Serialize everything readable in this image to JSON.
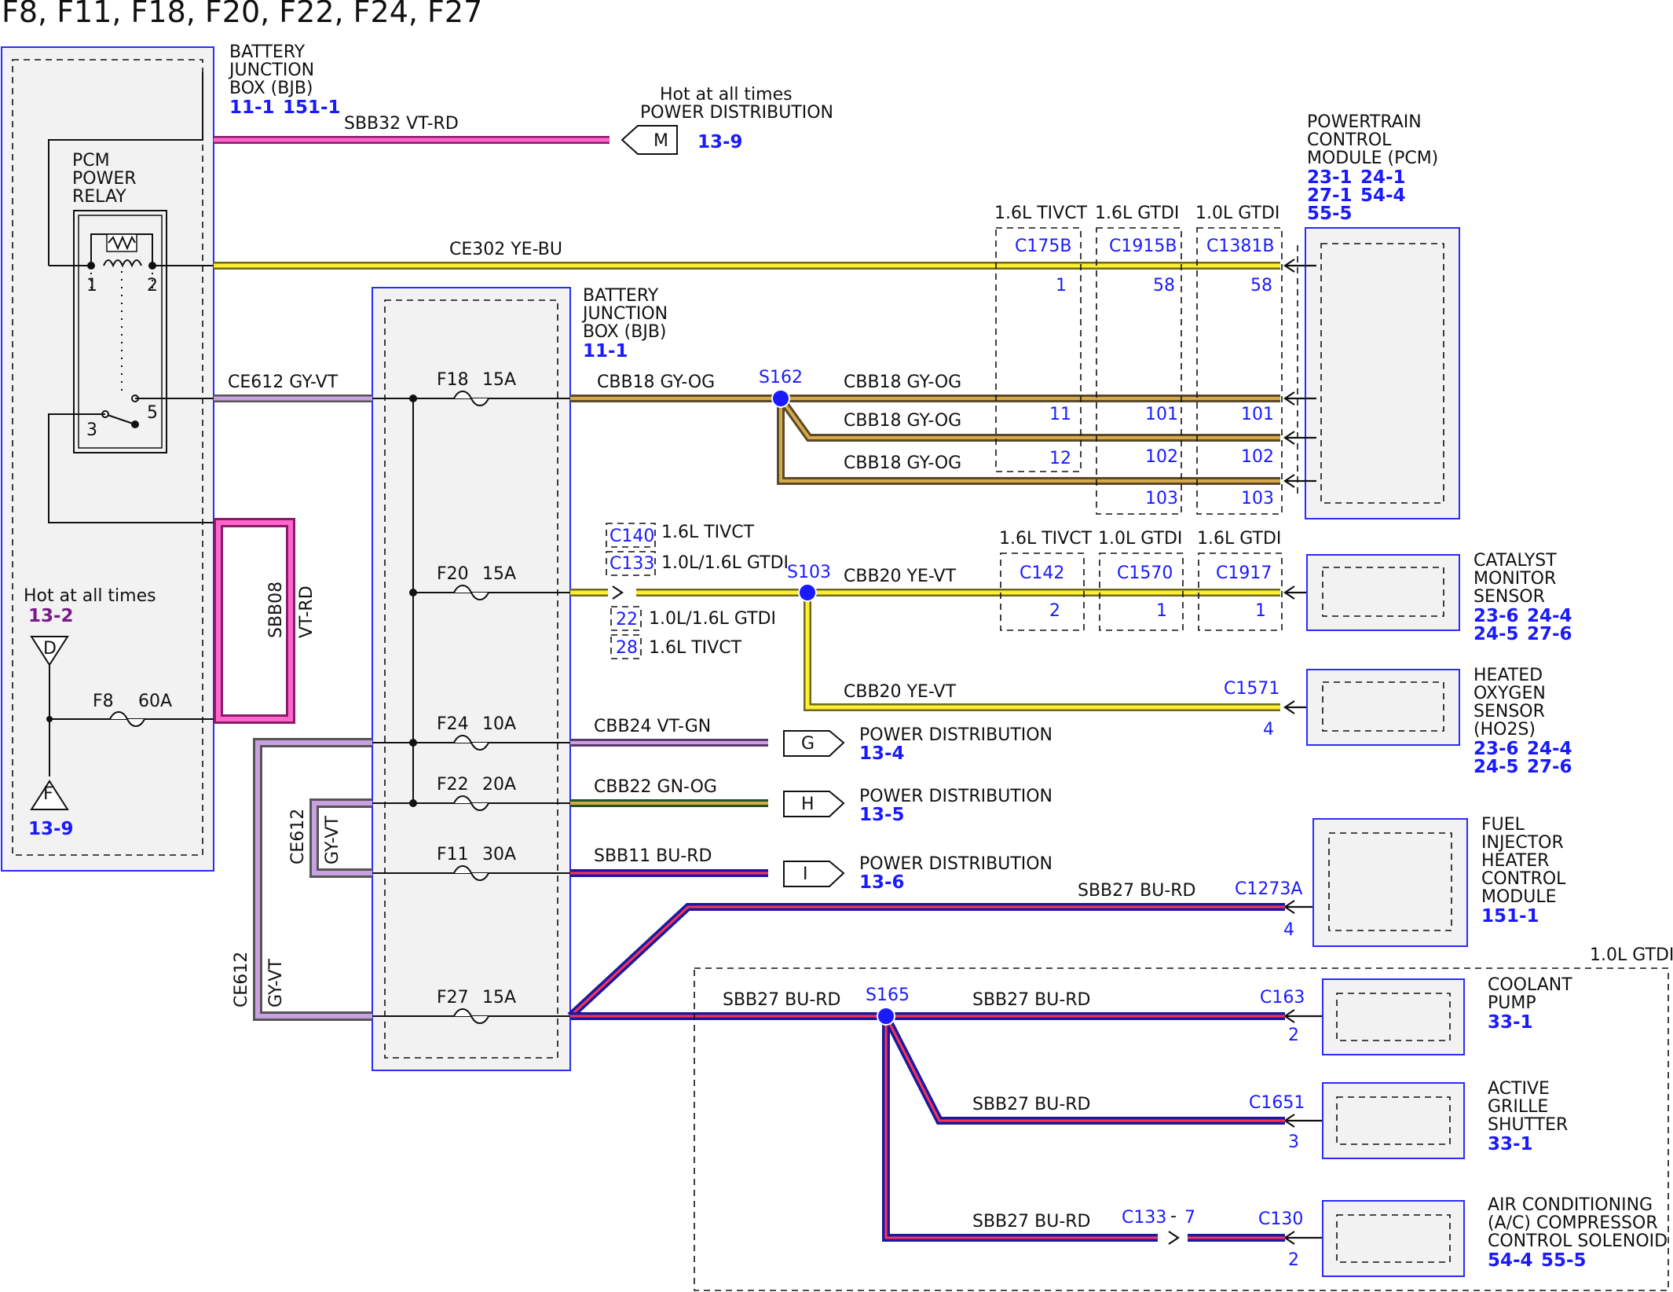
{
  "title": "F8, F11, F18, F20, F22, F24, F27",
  "bjb_left": {
    "label": [
      "BATTERY",
      "JUNCTION",
      "BOX (BJB)"
    ],
    "refs": [
      "11-1",
      "151-1"
    ]
  },
  "bjb_center": {
    "label": [
      "BATTERY",
      "JUNCTION",
      "BOX (BJB)"
    ],
    "refs": [
      "11-1"
    ]
  },
  "pcm_relay": {
    "label": [
      "PCM",
      "POWER",
      "RELAY"
    ],
    "pins": [
      "1",
      "2",
      "3",
      "5"
    ]
  },
  "hot_top": {
    "label": "Hot at all times",
    "sub": "POWER DISTRIBUTION",
    "connector": "M",
    "ref": "13-9"
  },
  "hot_left": {
    "label": "Hot at all times",
    "ref": "13-2",
    "top_connector": "D",
    "bottom_connector": "F",
    "bottom_ref": "13-9"
  },
  "pcm": {
    "label": [
      "POWERTRAIN",
      "CONTROL",
      "MODULE (PCM)"
    ],
    "refs": [
      "23-1",
      "24-1",
      "27-1",
      "54-4",
      "55-5"
    ]
  },
  "pcm_variants": [
    {
      "engine": "1.6L TIVCT",
      "connector": "C175B",
      "pins": [
        "1",
        "11",
        "12"
      ]
    },
    {
      "engine": "1.6L GTDI",
      "connector": "C1915B",
      "pins": [
        "58",
        "101",
        "102",
        "103"
      ]
    },
    {
      "engine": "1.0L GTDI",
      "connector": "C1381B",
      "pins": [
        "58",
        "101",
        "102",
        "103"
      ]
    }
  ],
  "cat_variants": [
    {
      "engine": "1.6L TIVCT",
      "connector": "C142",
      "pin": "2"
    },
    {
      "engine": "1.0L GTDI",
      "connector": "C1570",
      "pin": "1"
    },
    {
      "engine": "1.6L GTDI",
      "connector": "C1917",
      "pin": "1"
    }
  ],
  "wires": {
    "sbb32": "SBB32  VT-RD",
    "ce302": "CE302    YE-BU",
    "ce612": "CE612  GY-VT",
    "cbb18": "CBB18    GY-OG",
    "cbb20": "CBB20  YE-VT",
    "cbb24": "CBB24  VT-GN",
    "cbb22": "CBB22  GN-OG",
    "sbb11": "SBB11  BU-RD",
    "sbb27": "SBB27  BU-RD",
    "sbb08": "SBB08",
    "sbb08_color": "VT-RD",
    "ce612_v": "CE612",
    "gyvt": "GY-VT"
  },
  "fuses": [
    {
      "name": "F18",
      "rating": "15A"
    },
    {
      "name": "F20",
      "rating": "15A"
    },
    {
      "name": "F24",
      "rating": "10A"
    },
    {
      "name": "F22",
      "rating": "20A"
    },
    {
      "name": "F11",
      "rating": "30A"
    },
    {
      "name": "F27",
      "rating": "15A"
    },
    {
      "name": "F8",
      "rating": "60A"
    }
  ],
  "splices": {
    "s162": "S162",
    "s103": "S103",
    "s165": "S165"
  },
  "inline": {
    "c140": "C140",
    "c140_note": "1.6L TIVCT",
    "c133": "C133",
    "c133_note": "1.0L/1.6L GTDI",
    "p22": "22",
    "p22_note": "1.0L/1.6L GTDI",
    "p28": "28",
    "p28_note": "1.6L TIVCT"
  },
  "power_dist": [
    {
      "connector": "G",
      "label": "POWER DISTRIBUTION",
      "ref": "13-4"
    },
    {
      "connector": "H",
      "label": "POWER DISTRIBUTION",
      "ref": "13-5"
    },
    {
      "connector": "I",
      "label": "POWER DISTRIBUTION",
      "ref": "13-6"
    }
  ],
  "components": {
    "catalyst": {
      "label": [
        "CATALYST",
        "MONITOR",
        "SENSOR"
      ],
      "refs": [
        "23-6",
        "24-4",
        "24-5",
        "27-6"
      ]
    },
    "ho2s": {
      "label": [
        "HEATED",
        "OXYGEN",
        "SENSOR",
        "(HO2S)"
      ],
      "refs": [
        "23-6",
        "24-4",
        "24-5",
        "27-6"
      ],
      "connector": "C1571",
      "pin": "4"
    },
    "fihcm": {
      "label": [
        "FUEL",
        "INJECTOR",
        "HEATER",
        "CONTROL",
        "MODULE"
      ],
      "refs": [
        "151-1"
      ],
      "connector": "C1273A",
      "pin": "4"
    },
    "coolant": {
      "label": [
        "COOLANT",
        "PUMP"
      ],
      "refs": [
        "33-1"
      ],
      "connector": "C163",
      "pin": "2"
    },
    "grille": {
      "label": [
        "ACTIVE",
        "GRILLE",
        "SHUTTER"
      ],
      "refs": [
        "33-1"
      ],
      "connector": "C1651",
      "pin": "3"
    },
    "ac": {
      "label": [
        "AIR CONDITIONING",
        "(A/C) COMPRESSOR",
        "CONTROL SOLENOID"
      ],
      "refs": [
        "54-4",
        "55-5"
      ],
      "connector": "C130",
      "pin": "2",
      "inline_connector": "C133",
      "inline_sep": "-",
      "inline_pin": "7"
    }
  },
  "gtdi_region": "1.0L GTDI",
  "colors": {
    "box_border": "#2b2bff",
    "ref_blue": "#1a1aff",
    "ref_purple": "#7a1a8a",
    "box_fill": "#f2f2f2"
  }
}
